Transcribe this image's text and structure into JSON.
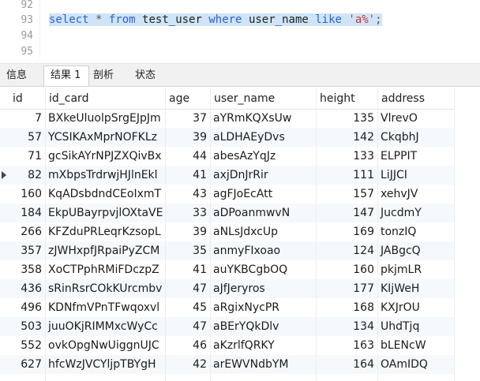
{
  "editor": {
    "line_numbers": [
      "92",
      "93",
      "94",
      "95"
    ],
    "sql": {
      "kw_select": "select",
      "star": "*",
      "kw_from": "from",
      "table": "test_user",
      "kw_where": "where",
      "column": "user_name",
      "kw_like": "like",
      "pattern": "'a%'",
      "semicolon": ";"
    }
  },
  "tabs": [
    "信息",
    "结果 1",
    "剖析",
    "状态"
  ],
  "active_tab": "结果 1",
  "grid": {
    "columns": [
      "id",
      "id_card",
      "age",
      "user_name",
      "height",
      "address"
    ],
    "rows": [
      [
        "7",
        "BXkeUluolpSrgEJpJm",
        "37",
        "aYRmKQXsUw",
        "135",
        "VlrevO"
      ],
      [
        "57",
        "YCSIKAxMprNOFKLz",
        "39",
        "aLDHAEyDvs",
        "142",
        "CkqbhJ"
      ],
      [
        "71",
        "gcSikAYrNPJZXQivBx",
        "44",
        "abesAzYqJz",
        "133",
        "ELPPIT"
      ],
      [
        "82",
        "mXbpsTrdrwjHJlnEkl",
        "41",
        "axjDnJrRir",
        "111",
        "LiJJCI"
      ],
      [
        "160",
        "KqADsbdndCEoIxmT",
        "43",
        "agFJoEcAtt",
        "157",
        "xehvJV"
      ],
      [
        "184",
        "EkpUBayrpvjlOXtaVE",
        "33",
        "aDPoanmwvN",
        "147",
        "JucdmY"
      ],
      [
        "266",
        "KFZduPRLeqrKzsopL",
        "39",
        "aNLsJdxcUp",
        "169",
        "tonzIQ"
      ],
      [
        "357",
        "zJWHxpfJRpaiPyZCM",
        "35",
        "anmyFIxoao",
        "124",
        "JABgcQ"
      ],
      [
        "358",
        "XoCTPphRMiFDczpZ",
        "41",
        "auYKBCgbOQ",
        "160",
        "pkjmLR"
      ],
      [
        "436",
        "sRinRsrCOkKUrcmbv",
        "47",
        "aJfJeryros",
        "177",
        "KIjWeH"
      ],
      [
        "496",
        "KDNfmVPnTFwqoxvl",
        "45",
        "aRgixNycPR",
        "168",
        "KXJrOU"
      ],
      [
        "503",
        "juuOKjRIMMxcWyCc",
        "47",
        "aBErYQkDlv",
        "134",
        "UhdTjq"
      ],
      [
        "552",
        "ovkOpgNwUiggnUJC",
        "46",
        "aKzrlfQRKY",
        "163",
        "bLENcW"
      ],
      [
        "627",
        "hfcWzJVCYljpTBYgH",
        "42",
        "arEWVNdbYM",
        "164",
        "OAmIDQ"
      ]
    ],
    "current_row_index": 3
  },
  "colors": {
    "selection": "#cfe4f7",
    "keyword": "#2f5fd0",
    "string": "#c63a3a",
    "alt_row": "#f5f9fc"
  }
}
